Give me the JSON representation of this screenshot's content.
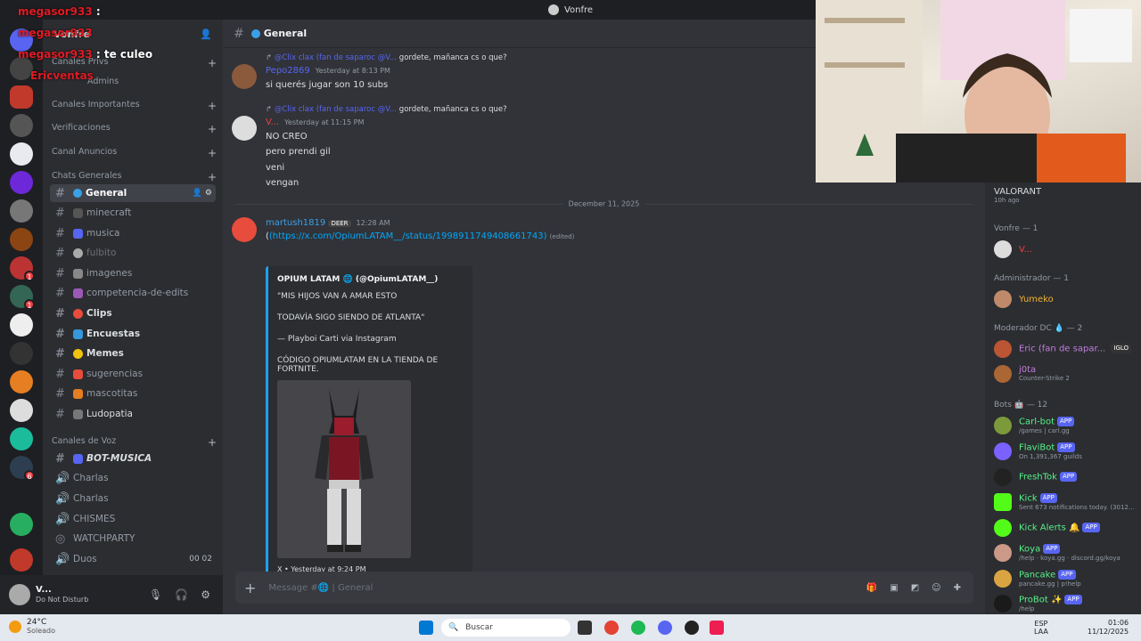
{
  "window": {
    "title": "Vonfre"
  },
  "overlay": {
    "chat": [
      {
        "user": "megasor933",
        "text": ":"
      },
      {
        "user": "megasor933",
        "text": ""
      },
      {
        "user": "megasor933",
        "text": ": te culeo"
      },
      {
        "user": "Ericventas",
        "text": ""
      }
    ]
  },
  "server": {
    "name": "Vonfre",
    "categories": [
      {
        "label": "Canales Privs"
      },
      {
        "label": "Admins"
      },
      {
        "label": "Canales Importantes"
      },
      {
        "label": "Verificaciones"
      },
      {
        "label": "Canal Anuncios"
      },
      {
        "label": "Chats Generales"
      },
      {
        "label": "Canales de Voz"
      }
    ],
    "channels": [
      {
        "label": "General"
      },
      {
        "label": "minecraft"
      },
      {
        "label": "musica"
      },
      {
        "label": "fulbito"
      },
      {
        "label": "imagenes"
      },
      {
        "label": "competencia-de-edits"
      },
      {
        "label": "Clips"
      },
      {
        "label": "Encuestas"
      },
      {
        "label": "Memes"
      },
      {
        "label": "sugerencias"
      },
      {
        "label": "mascotitas"
      },
      {
        "label": "Ludopatia"
      }
    ],
    "voice": [
      {
        "label": "BOT-MUSICA"
      },
      {
        "label": "Charlas"
      },
      {
        "label": "Charlas"
      },
      {
        "label": "CHISMES"
      },
      {
        "label": "WATCHPARTY"
      },
      {
        "label": "Duos",
        "c1": "00",
        "c2": "02"
      }
    ]
  },
  "user": {
    "name": "V...",
    "status": "Do Not Disturb"
  },
  "header": {
    "channel": "General"
  },
  "messages": {
    "m1": {
      "reply_name": "@Clix clax (fan de saparoc",
      "reply_tag": "@V...",
      "reply_text": "gordete, mañanca cs o que?",
      "author": "Pepo2869",
      "ts": "Yesterday at 8:13 PM",
      "text": "si querés jugar son 10 subs"
    },
    "m2": {
      "reply_name": "@Clix clax (fan de saparoc",
      "reply_tag": "@V...",
      "reply_text": "gordete, mañanca cs o que?",
      "author": "V...",
      "ts": "Yesterday at 11:15 PM",
      "lines": [
        "NO CREO",
        "pero prendi gil",
        "veni",
        "vengan"
      ]
    },
    "divider": "December 11, 2025",
    "m3": {
      "author": "martush1819",
      "tag": "DEER",
      "ts": "12:28 AM",
      "link": "(https://x.com/OpiumLATAM__/status/1998911749408661743)",
      "edited": "(edited)",
      "embed": {
        "title": "OPIUM LATAM 🌐 (@OpiumLATAM__)",
        "l1": "\"MIS HIJOS VAN A AMAR ESTO",
        "l2": "TODAVÍA SIGO SIENDO DE ATLANTA\"",
        "l3": "— Playboi Carti via Instagram",
        "l4": "CÓDIGO OPIUMLATAM EN LA TIENDA DE FORTNITE.",
        "footer": "X • Yesterday at 9:24 PM"
      }
    }
  },
  "composer": {
    "placeholder": "Message #🌐 | General"
  },
  "members": {
    "top": {
      "name": "VALORANT",
      "sub": "10h ago"
    },
    "groups": [
      {
        "label": "Vonfre — 1"
      },
      {
        "label": "Administrador — 1"
      },
      {
        "label": "Moderador DC 💧 — 2"
      },
      {
        "label": "Bots 🤖 — 12"
      }
    ],
    "list": [
      {
        "name": "V...",
        "sub": "",
        "color": "#f23f43"
      },
      {
        "name": "Yumeko",
        "sub": "",
        "color": "#f0b232"
      },
      {
        "name": "Eric (fan de sapar...",
        "sub": "",
        "color": "#c27cdb",
        "tag": "IGLO"
      },
      {
        "name": "j0ta",
        "sub": "Counter-Strike 2",
        "color": "#c27cdb"
      },
      {
        "name": "Carl-bot",
        "sub": "/games | carl.gg",
        "color": "#57f287"
      },
      {
        "name": "FlaviBot",
        "sub": "On 1,391,367 guilds",
        "color": "#57f287"
      },
      {
        "name": "FreshTok",
        "sub": "",
        "color": "#57f287"
      },
      {
        "name": "Kick",
        "sub": "Sent 673 notifications today. (3012...",
        "color": "#57f287"
      },
      {
        "name": "Kick Alerts 🔔",
        "sub": "",
        "color": "#57f287"
      },
      {
        "name": "Koya",
        "sub": "/help · koya.gg · discord.gg/koya",
        "color": "#57f287"
      },
      {
        "name": "Pancake",
        "sub": "pancake.gg | p!help",
        "color": "#57f287"
      },
      {
        "name": "ProBot ✨",
        "sub": "/help",
        "color": "#57f287"
      }
    ],
    "app": "APP"
  },
  "taskbar": {
    "weather_temp": "24°C",
    "weather_desc": "Soleado",
    "search": "Buscar",
    "lang1": "ESP",
    "lang2": "LAA",
    "time": "01:06",
    "date": "11/12/2025"
  }
}
